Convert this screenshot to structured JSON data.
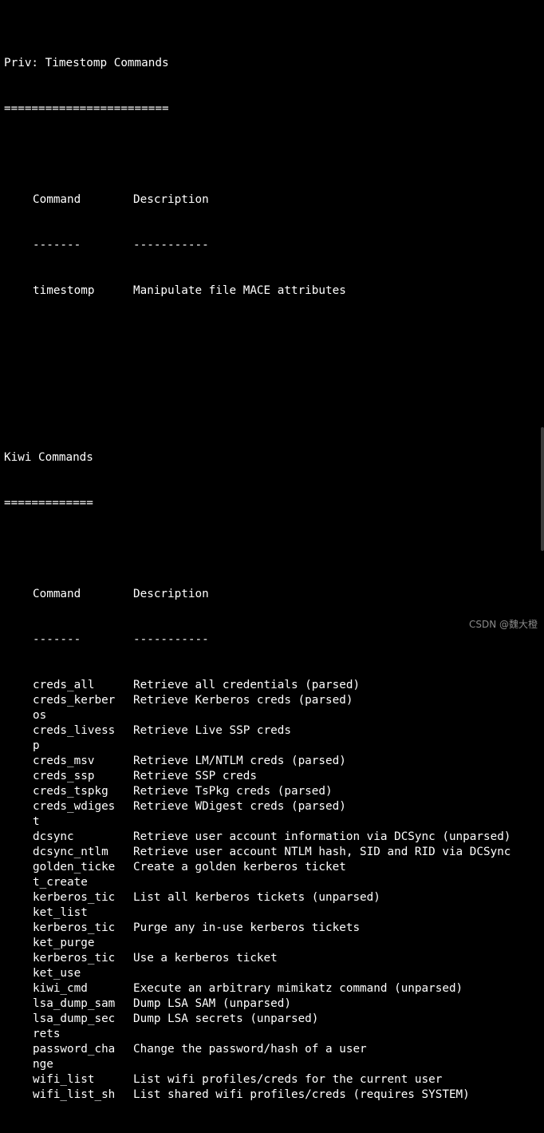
{
  "sections": [
    {
      "title": "Priv: Timestomp Commands",
      "underline": "========================",
      "header": {
        "command": "Command",
        "description": "Description"
      },
      "divider": {
        "command": "-------",
        "description": "-----------"
      },
      "rows": [
        {
          "command": "timestomp",
          "description": "Manipulate file MACE attributes"
        }
      ]
    },
    {
      "title": "Kiwi Commands",
      "underline": "=============",
      "header": {
        "command": "Command",
        "description": "Description"
      },
      "divider": {
        "command": "-------",
        "description": "-----------"
      },
      "rows": [
        {
          "command": "creds_all",
          "description": "Retrieve all credentials (parsed)"
        },
        {
          "command": "creds_kerber",
          "description": "Retrieve Kerberos creds (parsed)"
        },
        {
          "command": "os",
          "description": ""
        },
        {
          "command": "creds_livess",
          "description": "Retrieve Live SSP creds"
        },
        {
          "command": "p",
          "description": ""
        },
        {
          "command": "creds_msv",
          "description": "Retrieve LM/NTLM creds (parsed)"
        },
        {
          "command": "creds_ssp",
          "description": "Retrieve SSP creds"
        },
        {
          "command": "creds_tspkg",
          "description": "Retrieve TsPkg creds (parsed)"
        },
        {
          "command": "creds_wdiges",
          "description": "Retrieve WDigest creds (parsed)"
        },
        {
          "command": "t",
          "description": ""
        },
        {
          "command": "dcsync",
          "description": "Retrieve user account information via DCSync (unparsed)"
        },
        {
          "command": "dcsync_ntlm",
          "description": "Retrieve user account NTLM hash, SID and RID via DCSync"
        },
        {
          "command": "golden_ticke",
          "description": "Create a golden kerberos ticket"
        },
        {
          "command": "t_create",
          "description": ""
        },
        {
          "command": "kerberos_tic",
          "description": "List all kerberos tickets (unparsed)"
        },
        {
          "command": "ket_list",
          "description": ""
        },
        {
          "command": "kerberos_tic",
          "description": "Purge any in-use kerberos tickets"
        },
        {
          "command": "ket_purge",
          "description": ""
        },
        {
          "command": "kerberos_tic",
          "description": "Use a kerberos ticket"
        },
        {
          "command": "ket_use",
          "description": ""
        },
        {
          "command": "kiwi_cmd",
          "description": "Execute an arbitrary mimikatz command (unparsed)"
        },
        {
          "command": "lsa_dump_sam",
          "description": "Dump LSA SAM (unparsed)"
        },
        {
          "command": "lsa_dump_sec",
          "description": "Dump LSA secrets (unparsed)"
        },
        {
          "command": "rets",
          "description": ""
        },
        {
          "command": "password_cha",
          "description": "Change the password/hash of a user"
        },
        {
          "command": "nge",
          "description": ""
        },
        {
          "command": "wifi_list",
          "description": "List wifi profiles/creds for the current user"
        },
        {
          "command": "wifi_list_sh",
          "description": "List shared wifi profiles/creds (requires SYSTEM)"
        }
      ]
    }
  ],
  "watermark": "CSDN @魏大橙"
}
